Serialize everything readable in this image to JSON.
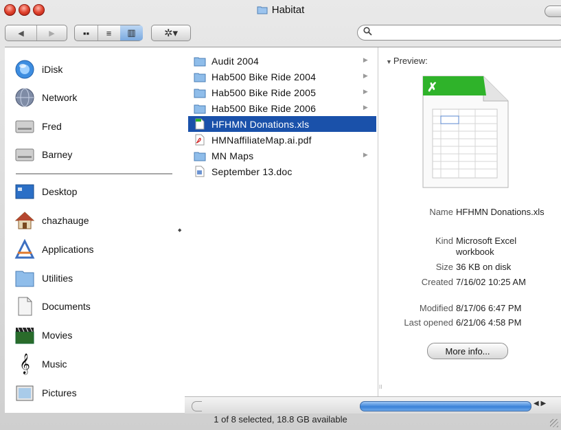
{
  "window": {
    "title": "Habitat"
  },
  "toolbar": {
    "back_icon": "◀",
    "forward_icon": "▶",
    "view_icon_icon": "▪▪",
    "view_list_icon": "≡",
    "view_column_icon": "▥",
    "action_icon": "✲▾"
  },
  "sidebar": {
    "devices": [
      {
        "label": "iDisk",
        "icon": "idisk-icon"
      },
      {
        "label": "Network",
        "icon": "network-globe-icon"
      },
      {
        "label": "Fred",
        "icon": "hard-drive-icon"
      },
      {
        "label": "Barney",
        "icon": "hard-drive-icon"
      }
    ],
    "places": [
      {
        "label": "Desktop",
        "icon": "desktop-icon"
      },
      {
        "label": "chazhauge",
        "icon": "home-icon"
      },
      {
        "label": "Applications",
        "icon": "applications-icon"
      },
      {
        "label": "Utilities",
        "icon": "folder-icon"
      },
      {
        "label": "Documents",
        "icon": "documents-icon"
      },
      {
        "label": "Movies",
        "icon": "clapperboard-icon"
      },
      {
        "label": "Music",
        "icon": "music-icon"
      },
      {
        "label": "Pictures",
        "icon": "pictures-icon"
      }
    ]
  },
  "files": [
    {
      "name": "Audit 2004",
      "kind": "folder",
      "has_children": true
    },
    {
      "name": "Hab500 Bike Ride 2004",
      "kind": "folder",
      "has_children": true
    },
    {
      "name": "Hab500 Bike Ride 2005",
      "kind": "folder",
      "has_children": true
    },
    {
      "name": "Hab500 Bike Ride 2006",
      "kind": "folder",
      "has_children": true
    },
    {
      "name": "HFHMN Donations.xls",
      "kind": "xls",
      "has_children": false,
      "selected": true
    },
    {
      "name": "HMNaffiliateMap.ai.pdf",
      "kind": "pdf",
      "has_children": false
    },
    {
      "name": "MN Maps",
      "kind": "folder",
      "has_children": true
    },
    {
      "name": "September 13.doc",
      "kind": "doc",
      "has_children": false
    }
  ],
  "preview": {
    "heading": "Preview:",
    "info": [
      {
        "label": "Name",
        "value": "HFHMN Donations.xls"
      },
      {
        "label": "Kind",
        "value": "Microsoft Excel workbook"
      },
      {
        "label": "Size",
        "value": "36 KB on disk"
      },
      {
        "label": "Created",
        "value": "7/16/02 10:25 AM"
      },
      {
        "label": "Modified",
        "value": "8/17/06 6:47 PM"
      },
      {
        "label": "Last opened",
        "value": "6/21/06 4:58 PM"
      }
    ],
    "more_info_label": "More info..."
  },
  "status": {
    "text": "1 of 8 selected, 18.8 GB available"
  },
  "colors": {
    "selection": "#1a51aa",
    "folder": "#7fb3e6",
    "excel_green": "#2fb32a"
  }
}
